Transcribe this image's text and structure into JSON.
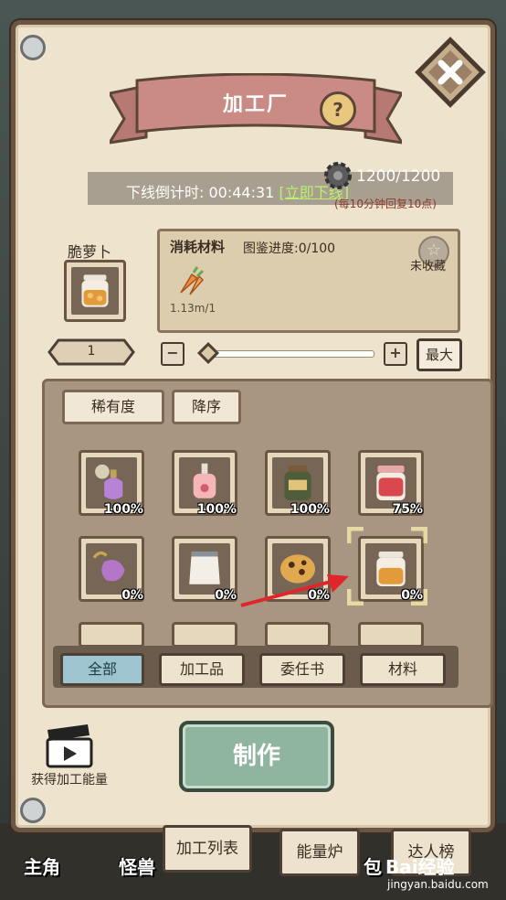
{
  "header": {
    "title": "加工厂",
    "help_label": "?",
    "close_label": "✕"
  },
  "timer": {
    "label": "下线倒计时:",
    "value": "00:44:31",
    "link": "[立即下线]"
  },
  "energy": {
    "value": "1200/1200",
    "note": "(每10分钟回复10点)"
  },
  "item": {
    "name": "脆萝卜"
  },
  "info": {
    "title": "消耗材料",
    "progress": "图鉴进度:0/100",
    "rate": "1.13m/1",
    "favorite_icon": "☆",
    "favorite_label": "未收藏"
  },
  "quantity": {
    "value": "1",
    "minus": "−",
    "plus": "+",
    "max_label": "最大"
  },
  "sort": {
    "rarity_label": "稀有度",
    "order_label": "降序"
  },
  "grid": [
    {
      "icon": "perfume-bottle-icon",
      "pct": "100%"
    },
    {
      "icon": "pink-bottle-icon",
      "pct": "100%"
    },
    {
      "icon": "jar-icon",
      "pct": "100%"
    },
    {
      "icon": "strawberry-jar-icon",
      "pct": "75%"
    },
    {
      "icon": "purple-pouch-icon",
      "pct": "0%"
    },
    {
      "icon": "flour-sack-icon",
      "pct": "0%"
    },
    {
      "icon": "cookie-icon",
      "pct": "0%"
    },
    {
      "icon": "honey-jar-icon",
      "pct": "0%"
    }
  ],
  "filters": {
    "all": "全部",
    "processed": "加工品",
    "commission": "委任书",
    "materials": "材料"
  },
  "actions": {
    "make_label": "制作",
    "energy_label": "获得加工能量"
  },
  "bottom_tabs": {
    "process_list": "加工列表",
    "energy_furnace": "能量炉",
    "leaderboard": "达人榜"
  },
  "bottom_nav": {
    "hero": "主角",
    "monster": "怪兽",
    "bag": "包"
  },
  "watermark": {
    "brand": "Bai经验",
    "url": "jingyan.baidu.com"
  },
  "colors": {
    "panel": "#eee3cc",
    "accent_green": "#8fb59e",
    "banner": "#c98b83",
    "link": "#b9f06e"
  }
}
